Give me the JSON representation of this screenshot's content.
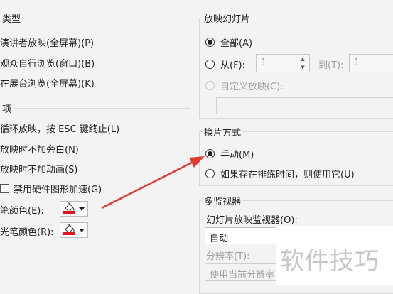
{
  "left": {
    "type_group": {
      "legend": "类型",
      "options": [
        "演讲者放映(全屏幕)(P)",
        "观众自行浏览(窗口)(B)",
        "在展台浏览(全屏幕)(K)"
      ]
    },
    "options_group": {
      "legend": "项",
      "checkboxes": [
        "循环放映，按 ESC 键终止(L)",
        "放映时不加旁白(N)",
        "放映时不加动画(S)",
        "禁用硬件图形加速(G)"
      ],
      "pen_color_label": "笔颜色(E):",
      "laser_color_label": "光笔颜色(R):"
    }
  },
  "right": {
    "slides_group": {
      "legend": "放映幻灯片",
      "all_label": "全部(A)",
      "from_label": "从(F):",
      "from_value": "1",
      "to_label": "到(T):",
      "to_value": "1",
      "custom_label": "自定义放映(C):"
    },
    "advance_group": {
      "legend": "换片方式",
      "manual_label": "手动(M)",
      "timings_label": "如果存在排练时间，则使用它(U)"
    },
    "monitors_group": {
      "legend": "多监视器",
      "monitor_label": "幻灯片放映监视器(O):",
      "monitor_value": "自动",
      "resolution_label": "分辨率(T):",
      "resolution_value": "使用当前分辨率"
    }
  },
  "annotation": {
    "arrow_color": "#e53935"
  },
  "watermark": {
    "text": "软件技巧"
  },
  "colors": {
    "pen_red": "#e0141b"
  }
}
